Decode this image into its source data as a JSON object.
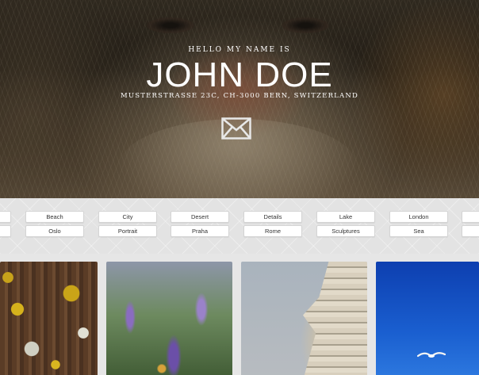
{
  "hero": {
    "intro": "HELLO MY NAME IS",
    "name": "JOHN DOE",
    "address": "MUSTERSTRASSE 23C, CH-3000 BERN, SWITZERLAND",
    "contact_icon": "envelope-icon"
  },
  "filters": {
    "row1": [
      "",
      "Beach",
      "City",
      "Desert",
      "Details",
      "Lake",
      "London",
      ""
    ],
    "row2": [
      "",
      "Oslo",
      "Portrait",
      "Praha",
      "Rome",
      "Sculptures",
      "Sea",
      ""
    ]
  },
  "gallery": {
    "photos": [
      "lichen-bark",
      "lavender-bee",
      "gothic-facade",
      "gull-blue-sky"
    ]
  },
  "colors": {
    "accent": "#ffffff",
    "filter_bg": "#e3e3e3",
    "tag_bg": "#ffffff",
    "tag_border": "#d4d4d4"
  }
}
